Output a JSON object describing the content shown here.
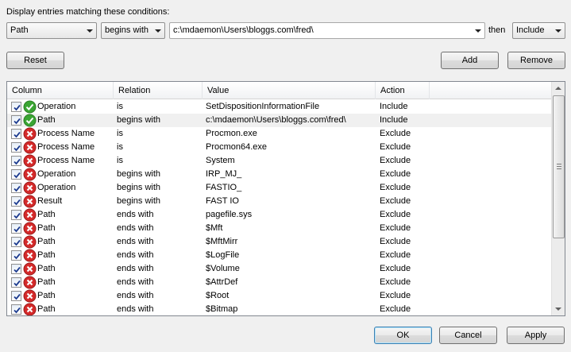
{
  "caption": "Display entries matching these conditions:",
  "filter": {
    "column": "Path",
    "relation": "begins with",
    "value": "c:\\mdaemon\\Users\\bloggs.com\\fred\\",
    "then_label": "then",
    "action": "Include"
  },
  "buttons": {
    "reset": "Reset",
    "add": "Add",
    "remove": "Remove",
    "ok": "OK",
    "cancel": "Cancel",
    "apply": "Apply"
  },
  "list": {
    "headers": {
      "column": "Column",
      "relation": "Relation",
      "value": "Value",
      "action": "Action"
    },
    "rows": [
      {
        "checked": true,
        "icon": "include-icon",
        "column": "Operation",
        "relation": "is",
        "value": "SetDispositionInformationFile",
        "action": "Include"
      },
      {
        "checked": true,
        "icon": "include-icon",
        "column": "Path",
        "relation": "begins with",
        "value": "c:\\mdaemon\\Users\\bloggs.com\\fred\\",
        "action": "Include"
      },
      {
        "checked": true,
        "icon": "exclude-icon",
        "column": "Process Name",
        "relation": "is",
        "value": "Procmon.exe",
        "action": "Exclude"
      },
      {
        "checked": true,
        "icon": "exclude-icon",
        "column": "Process Name",
        "relation": "is",
        "value": "Procmon64.exe",
        "action": "Exclude"
      },
      {
        "checked": true,
        "icon": "exclude-icon",
        "column": "Process Name",
        "relation": "is",
        "value": "System",
        "action": "Exclude"
      },
      {
        "checked": true,
        "icon": "exclude-icon",
        "column": "Operation",
        "relation": "begins with",
        "value": "IRP_MJ_",
        "action": "Exclude"
      },
      {
        "checked": true,
        "icon": "exclude-icon",
        "column": "Operation",
        "relation": "begins with",
        "value": "FASTIO_",
        "action": "Exclude"
      },
      {
        "checked": true,
        "icon": "exclude-icon",
        "column": "Result",
        "relation": "begins with",
        "value": "FAST IO",
        "action": "Exclude"
      },
      {
        "checked": true,
        "icon": "exclude-icon",
        "column": "Path",
        "relation": "ends with",
        "value": "pagefile.sys",
        "action": "Exclude"
      },
      {
        "checked": true,
        "icon": "exclude-icon",
        "column": "Path",
        "relation": "ends with",
        "value": "$Mft",
        "action": "Exclude"
      },
      {
        "checked": true,
        "icon": "exclude-icon",
        "column": "Path",
        "relation": "ends with",
        "value": "$MftMirr",
        "action": "Exclude"
      },
      {
        "checked": true,
        "icon": "exclude-icon",
        "column": "Path",
        "relation": "ends with",
        "value": "$LogFile",
        "action": "Exclude"
      },
      {
        "checked": true,
        "icon": "exclude-icon",
        "column": "Path",
        "relation": "ends with",
        "value": "$Volume",
        "action": "Exclude"
      },
      {
        "checked": true,
        "icon": "exclude-icon",
        "column": "Path",
        "relation": "ends with",
        "value": "$AttrDef",
        "action": "Exclude"
      },
      {
        "checked": true,
        "icon": "exclude-icon",
        "column": "Path",
        "relation": "ends with",
        "value": "$Root",
        "action": "Exclude"
      },
      {
        "checked": true,
        "icon": "exclude-icon",
        "column": "Path",
        "relation": "ends with",
        "value": "$Bitmap",
        "action": "Exclude"
      }
    ],
    "selected_row": 1
  },
  "colors": {
    "include": "#3aa533",
    "exclude": "#d42a2a"
  }
}
